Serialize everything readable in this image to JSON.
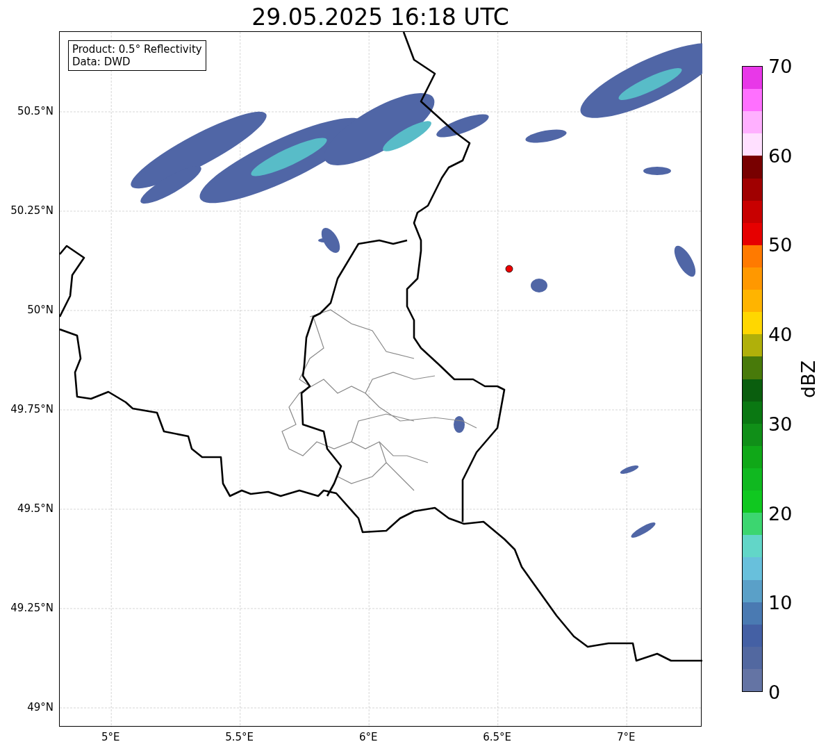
{
  "title": "29.05.2025 16:18 UTC",
  "legend": [
    "Product: 0.5° Reflectivity",
    "Data: DWD"
  ],
  "lat_ticks": [
    "50.5°N",
    "50.25°N",
    "50°N",
    "49.75°N",
    "49.5°N",
    "49.25°N",
    "49°N"
  ],
  "lon_ticks": [
    "5°E",
    "5.5°E",
    "6°E",
    "6.5°E",
    "7°E"
  ],
  "colorbar": {
    "label": "dBZ",
    "ticks": [
      "70",
      "60",
      "50",
      "40",
      "30",
      "20",
      "10",
      "0"
    ],
    "bands": [
      {
        "color": "#e838e8"
      },
      {
        "color": "#ff70ff"
      },
      {
        "color": "#ffb0ff"
      },
      {
        "color": "#ffe0ff"
      },
      {
        "color": "#780000"
      },
      {
        "color": "#a00000"
      },
      {
        "color": "#c80000"
      },
      {
        "color": "#e60000"
      },
      {
        "color": "#ff7a00"
      },
      {
        "color": "#ff9800"
      },
      {
        "color": "#ffb400"
      },
      {
        "color": "#ffd700"
      },
      {
        "color": "#b0b00a"
      },
      {
        "color": "#487a0a"
      },
      {
        "color": "#0a5e0e"
      },
      {
        "color": "#0a7812"
      },
      {
        "color": "#108f18"
      },
      {
        "color": "#10a818"
      },
      {
        "color": "#10b820"
      },
      {
        "color": "#10c820"
      },
      {
        "color": "#3cd670"
      },
      {
        "color": "#62d6c8"
      },
      {
        "color": "#68c0dc"
      },
      {
        "color": "#5aa0c8"
      },
      {
        "color": "#4a7ab2"
      },
      {
        "color": "#4460a4"
      },
      {
        "color": "#5268a0"
      },
      {
        "color": "#6474a4"
      }
    ]
  }
}
